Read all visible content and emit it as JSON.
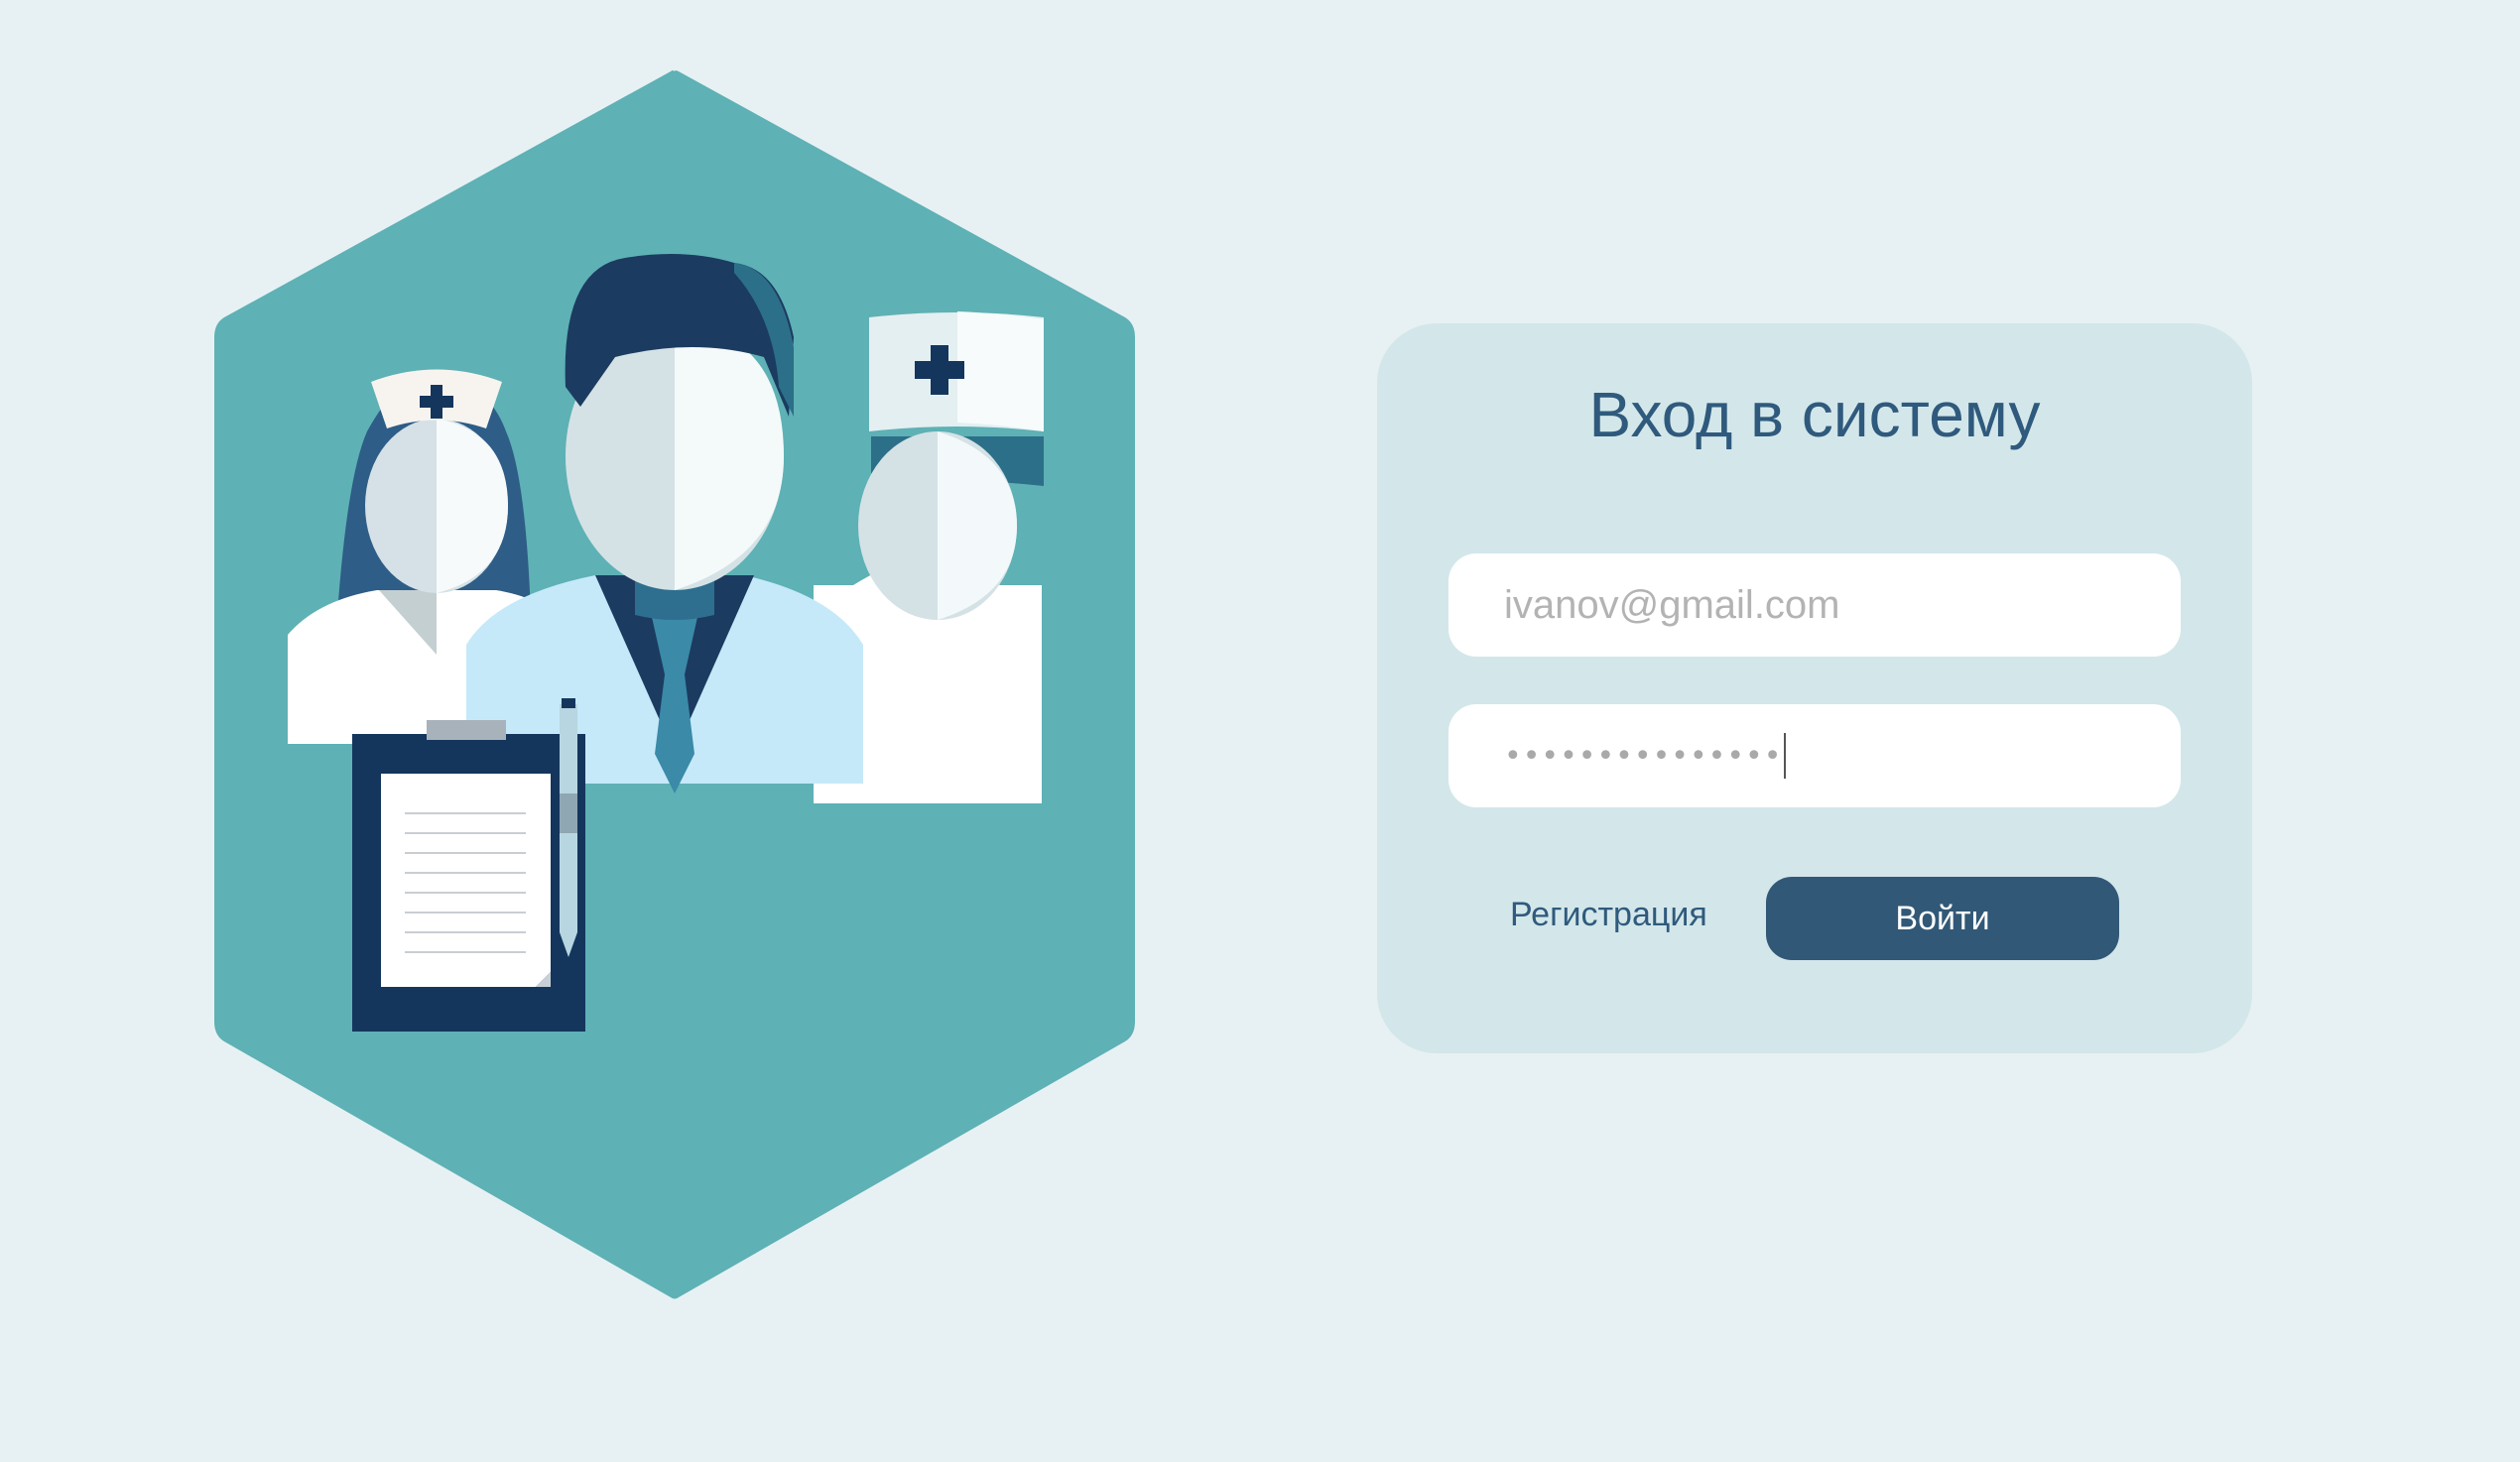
{
  "illustration": {
    "name": "medical-team-illustration",
    "hexagon_color": "#5eb1b5",
    "clipboard_color": "#14365d"
  },
  "login": {
    "title": "Вход в систему",
    "email_placeholder": "ivanov@gmail.com",
    "password_masked": "•••••••••••••••",
    "register_label": "Регистрация",
    "submit_label": "Войти"
  },
  "colors": {
    "background": "#e7f1f3",
    "card": "#d3e7ea",
    "accent": "#325877",
    "title": "#2f5a7d"
  }
}
